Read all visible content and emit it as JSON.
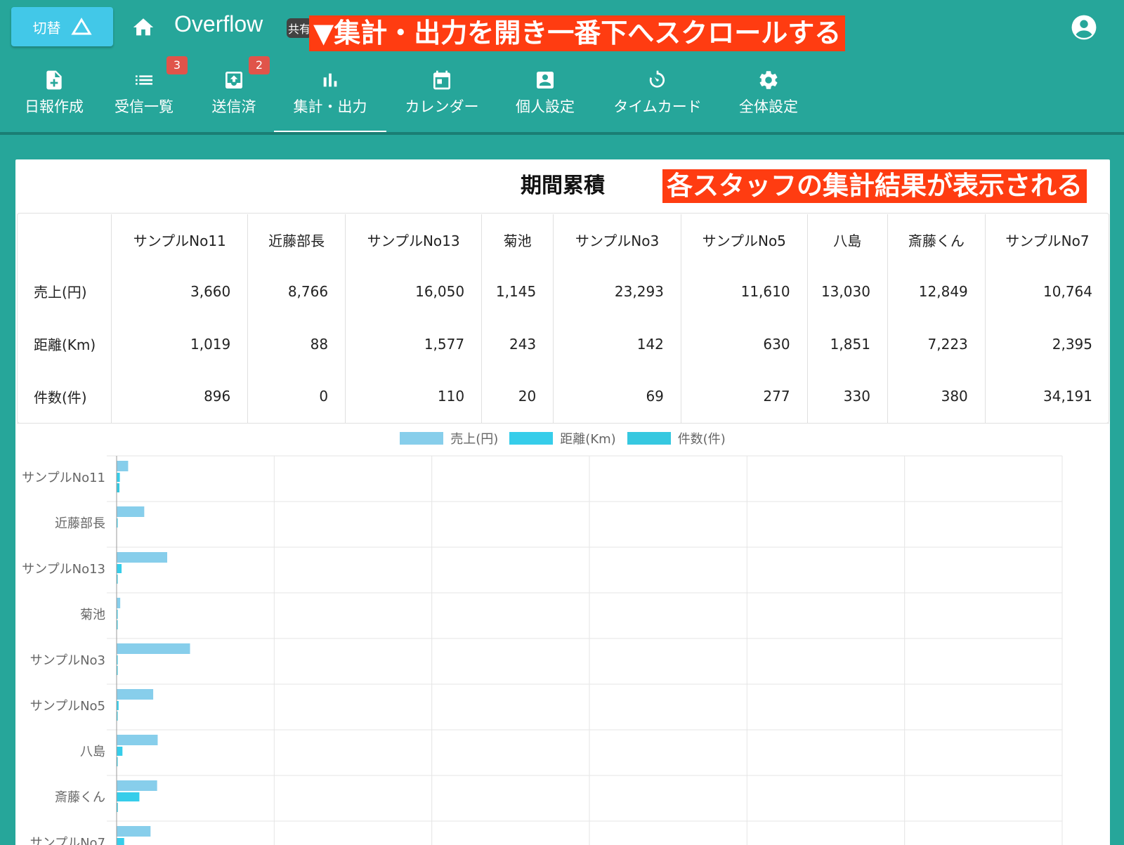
{
  "header": {
    "switch_label": "切替",
    "app_title": "Overflow",
    "shared_badge": "共有",
    "annotation": "▼集計・出力を開き一番下へスクロールする"
  },
  "nav": {
    "items": [
      {
        "label": "日報作成",
        "icon": "note-add-icon"
      },
      {
        "label": "受信一覧",
        "icon": "list-icon",
        "count": "3"
      },
      {
        "label": "送信済",
        "icon": "outbox-icon",
        "count": "2"
      },
      {
        "label": "集計・出力",
        "icon": "bar-chart-icon",
        "active": true
      },
      {
        "label": "カレンダー",
        "icon": "calendar-icon"
      },
      {
        "label": "個人設定",
        "icon": "person-card-icon"
      },
      {
        "label": "タイムカード",
        "icon": "timer-icon"
      },
      {
        "label": "全体設定",
        "icon": "gear-icon"
      }
    ]
  },
  "card": {
    "title": "期間累積",
    "annotation": "各スタッフの集計結果が表示される"
  },
  "summary_table": {
    "columns": [
      "サンプルNo11",
      "近藤部長",
      "サンプルNo13",
      "菊池",
      "サンプルNo3",
      "サンプルNo5",
      "八島",
      "斎藤くん",
      "サンプルNo7"
    ],
    "rows": [
      {
        "label": "売上(円)",
        "values": [
          "3,660",
          "8,766",
          "16,050",
          "1,145",
          "23,293",
          "11,610",
          "13,030",
          "12,849",
          "10,764"
        ]
      },
      {
        "label": "距離(Km)",
        "values": [
          "1,019",
          "88",
          "1,577",
          "243",
          "142",
          "630",
          "1,851",
          "7,223",
          "2,395"
        ]
      },
      {
        "label": "件数(件)",
        "values": [
          "896",
          "0",
          "110",
          "20",
          "69",
          "277",
          "330",
          "380",
          "34,191"
        ]
      }
    ]
  },
  "chart_data": {
    "type": "bar",
    "orientation": "horizontal",
    "categories": [
      "サンプルNo11",
      "近藤部長",
      "サンプルNo13",
      "菊池",
      "サンプルNo3",
      "サンプルNo5",
      "八島",
      "斎藤くん",
      "サンプルNo7"
    ],
    "series": [
      {
        "name": "売上(円)",
        "color": "#87ceeb",
        "values": [
          3660,
          8766,
          16050,
          1145,
          23293,
          11610,
          13030,
          12849,
          10764
        ]
      },
      {
        "name": "距離(Km)",
        "color": "#36cdea",
        "values": [
          1019,
          88,
          1577,
          243,
          142,
          630,
          1851,
          7223,
          2395
        ]
      },
      {
        "name": "件数(件)",
        "color": "#36c8e0",
        "values": [
          896,
          0,
          110,
          20,
          69,
          277,
          330,
          380,
          34191
        ]
      }
    ],
    "xlim": [
      0,
      300000
    ],
    "grid": true,
    "legend": "top-center"
  }
}
